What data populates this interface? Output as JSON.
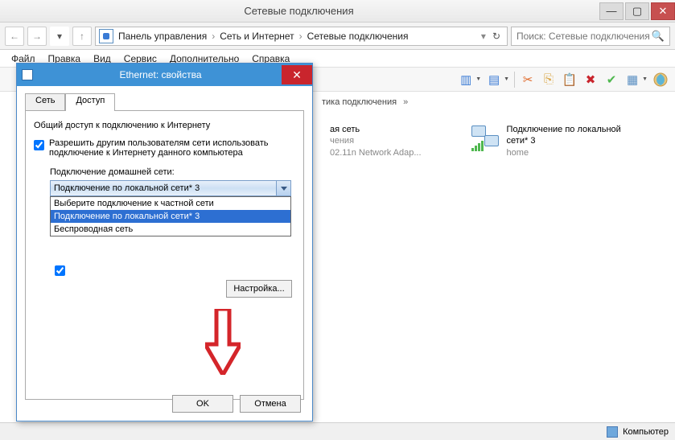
{
  "window": {
    "title": "Сетевые подключения",
    "minimize": "—",
    "maximize": "▢",
    "close": "✕"
  },
  "breadcrumb": {
    "items": [
      "Панель управления",
      "Сеть и Интернет",
      "Сетевые подключения"
    ],
    "refresh_label": "↻",
    "back": "←",
    "forward": "→",
    "up": "↑"
  },
  "search": {
    "placeholder": "Поиск: Сетевые подключения",
    "icon": "🔍"
  },
  "menu": {
    "items": [
      "Файл",
      "Правка",
      "Вид",
      "Сервис",
      "Дополнительно",
      "Справка"
    ]
  },
  "subbar": {
    "label": "тика подключения",
    "chev": "»"
  },
  "connections": {
    "partial": {
      "line1": "ая сеть",
      "line2": "чения",
      "line3": "02.11n Network Adap..."
    },
    "lan3": {
      "title": "Подключение по локальной сети* 3",
      "sub": "home"
    }
  },
  "statusbar": {
    "label": "Компьютер"
  },
  "dialog": {
    "title": "Ethernet: свойства",
    "close": "✕",
    "tabs": {
      "network": "Сеть",
      "access": "Доступ"
    },
    "section": "Общий доступ к подключению к Интернету",
    "chk1": "Разрешить другим пользователям сети использовать подключение к Интернету данного компьютера",
    "home_label": "Подключение домашней сети:",
    "combo_value": "Подключение по локальной сети* 3",
    "dropdown": {
      "opt1": "Выберите подключение к частной сети",
      "opt2": "Подключение по локальной сети* 3",
      "opt3": "Беспроводная сеть"
    },
    "config_btn": "Настройка...",
    "ok": "OK",
    "cancel": "Отмена"
  }
}
